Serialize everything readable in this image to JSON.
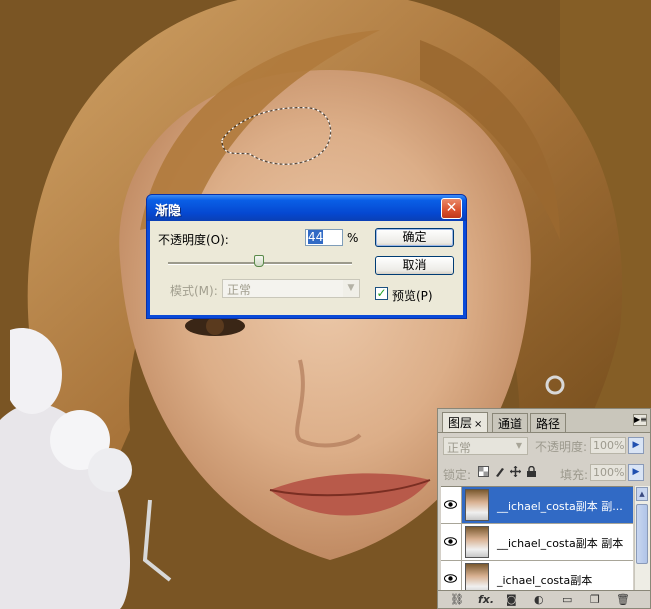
{
  "fade_dialog": {
    "title": "渐隐",
    "close_glyph": "✕",
    "opacity_label": "不透明度(O):",
    "opacity_value": "44",
    "percent_sign": "%",
    "slider_value_percent": 44,
    "mode_label": "模式(M):",
    "mode_value": "正常",
    "ok_label": "确定",
    "cancel_label": "取消",
    "preview_label": "预览(P)",
    "preview_checked": true
  },
  "layers_panel": {
    "tabs": [
      {
        "label": "图层"
      },
      {
        "label": "通道"
      },
      {
        "label": "路径"
      }
    ],
    "tab_close_glyph": "×",
    "menu_glyph": "▶≡",
    "blend_mode": "正常",
    "opacity_label": "不透明度:",
    "opacity_value": "100%",
    "lock_label": "锁定:",
    "fill_label": "填充:",
    "fill_value": "100%",
    "layers": [
      {
        "name": "__ichael_costa副本 副...",
        "selected": true,
        "visible": true
      },
      {
        "name": "__ichael_costa副本 副本",
        "selected": false,
        "visible": true
      },
      {
        "name": "_ichael_costa副本",
        "selected": false,
        "visible": true
      }
    ],
    "footer_icons": [
      "link-icon",
      "fx-icon",
      "mask-icon",
      "adjustment-icon",
      "group-folder-icon",
      "new-layer-icon",
      "trash-icon"
    ]
  },
  "colors": {
    "xp_title_blue": "#0548d1",
    "selection_blue": "#316ac5",
    "dialog_face": "#ece9d8"
  }
}
